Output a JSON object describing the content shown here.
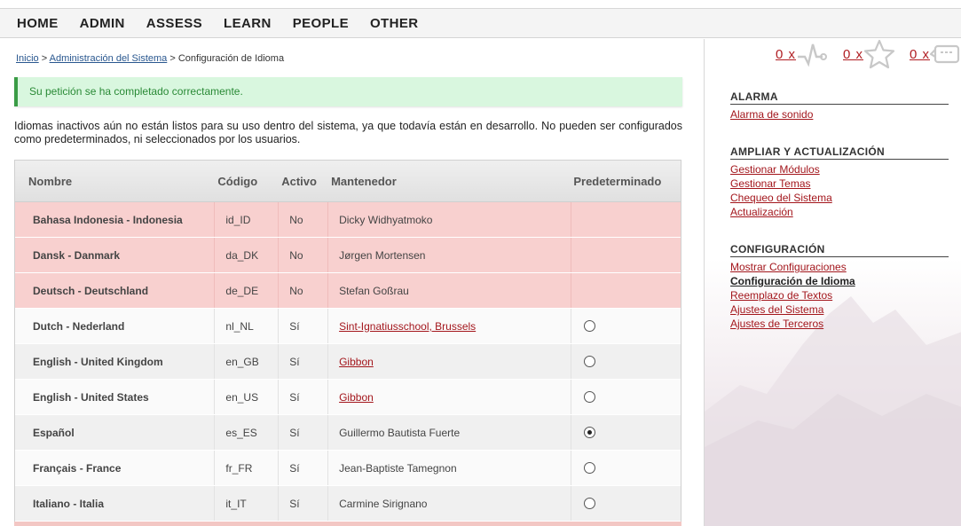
{
  "menu": [
    "HOME",
    "ADMIN",
    "ASSESS",
    "LEARN",
    "PEOPLE",
    "OTHER"
  ],
  "breadcrumb": {
    "home": "Inicio",
    "sep1": " > ",
    "admin": "Administración del Sistema",
    "sep2": " > ",
    "current": "Configuración de Idioma"
  },
  "success_message": "Su petición se ha completado correctamente.",
  "intro_text": "Idiomas inactivos aún no están listos para su uso dentro del sistema, ya que todavía están en desarrollo. No pueden ser configurados como predeterminados, ni seleccionados por los usuarios.",
  "table": {
    "headers": [
      "Nombre",
      "Código",
      "Activo",
      "Mantenedor",
      "Predeterminado"
    ],
    "rows": [
      {
        "name": "Bahasa Indonesia - Indonesia",
        "code": "id_ID",
        "active": "No",
        "maintainer": "Dicky Widhyatmoko",
        "maintainer_link": false,
        "default": null
      },
      {
        "name": "Dansk - Danmark",
        "code": "da_DK",
        "active": "No",
        "maintainer": "Jørgen Mortensen",
        "maintainer_link": false,
        "default": null
      },
      {
        "name": "Deutsch - Deutschland",
        "code": "de_DE",
        "active": "No",
        "maintainer": "Stefan Goßrau",
        "maintainer_link": false,
        "default": null
      },
      {
        "name": "Dutch - Nederland",
        "code": "nl_NL",
        "active": "Sí",
        "maintainer": "Sint-Ignatiusschool, Brussels",
        "maintainer_link": true,
        "default": false
      },
      {
        "name": "English - United Kingdom",
        "code": "en_GB",
        "active": "Sí",
        "maintainer": "Gibbon",
        "maintainer_link": true,
        "default": false
      },
      {
        "name": "English - United States",
        "code": "en_US",
        "active": "Sí",
        "maintainer": "Gibbon",
        "maintainer_link": true,
        "default": false
      },
      {
        "name": "Español",
        "code": "es_ES",
        "active": "Sí",
        "maintainer": "Guillermo Bautista Fuerte",
        "maintainer_link": false,
        "default": true
      },
      {
        "name": "Français - France",
        "code": "fr_FR",
        "active": "Sí",
        "maintainer": "Jean-Baptiste Tamegnon",
        "maintainer_link": false,
        "default": false
      },
      {
        "name": "Italiano - Italia",
        "code": "it_IT",
        "active": "Sí",
        "maintainer": "Carmine Sirignano",
        "maintainer_link": false,
        "default": false
      }
    ]
  },
  "notifications": [
    {
      "count": "0 x",
      "icon": "pulse-icon"
    },
    {
      "count": "0 x",
      "icon": "star-icon"
    },
    {
      "count": "0 x",
      "icon": "message-icon"
    }
  ],
  "sidebar": {
    "sections": [
      {
        "title": "ALARMA",
        "links": [
          "Alarma de sonido"
        ],
        "current": -1
      },
      {
        "title": "AMPLIAR Y ACTUALIZACIÓN",
        "links": [
          "Gestionar Módulos",
          "Gestionar Temas",
          "Chequeo del Sistema",
          "Actualización"
        ],
        "current": -1
      },
      {
        "title": "CONFIGURACIÓN",
        "links": [
          "Mostrar Configuraciones",
          "Configuración de Idioma",
          "Reemplazo de Textos",
          "Ajustes del Sistema",
          "Ajustes de Terceros"
        ],
        "current": 1
      }
    ]
  },
  "colors": {
    "link_red": "#a3161c",
    "link_blue": "#29578f",
    "success_bg": "#d9f7df",
    "success_text": "#2a8a36",
    "inactive_row": "#f8d0cf"
  }
}
